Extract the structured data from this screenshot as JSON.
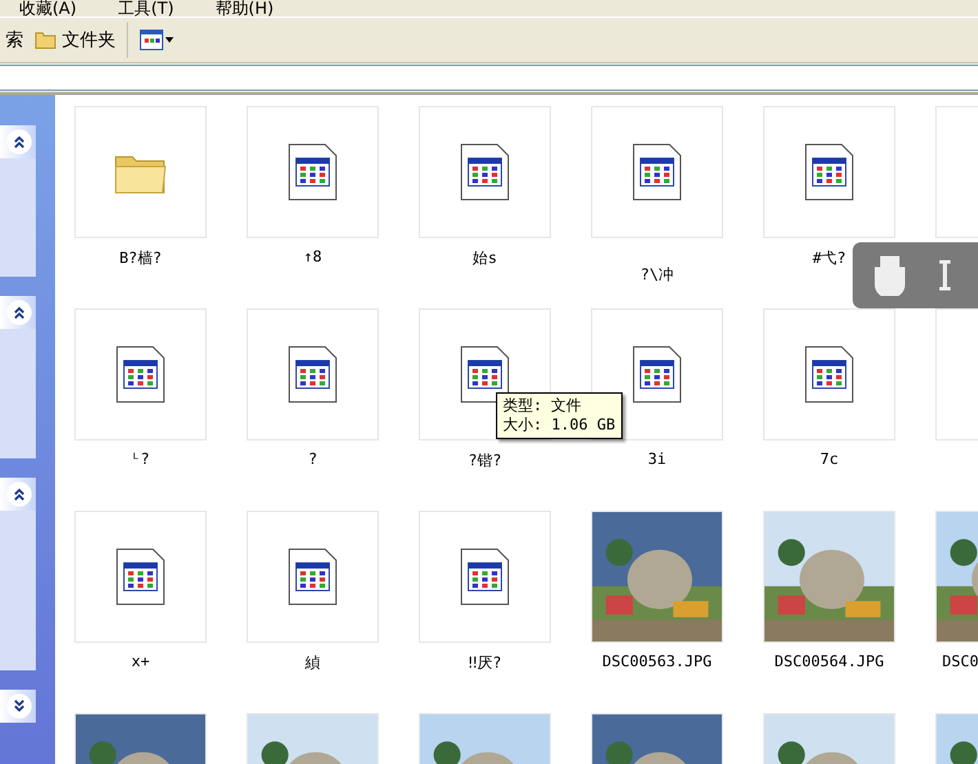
{
  "menu": [
    "收藏(A)",
    "工具(T)",
    "帮助(H)"
  ],
  "toolbar": {
    "search_label": "索",
    "folders_label": "文件夹"
  },
  "sidebar": {
    "panels": [
      {
        "expanded": true
      },
      {
        "expanded": true
      },
      {
        "expanded": true
      },
      {
        "expanded": false
      }
    ]
  },
  "items": [
    {
      "kind": "folder",
      "label": "B?樯?"
    },
    {
      "kind": "file",
      "label": "↑8"
    },
    {
      "kind": "file",
      "label": "始s"
    },
    {
      "kind": "file",
      "label": "?\\冲"
    },
    {
      "kind": "file",
      "label": "#弋?"
    },
    {
      "kind": "blank"
    },
    {
      "kind": "file",
      "label": "ᴸ?"
    },
    {
      "kind": "file",
      "label": "?"
    },
    {
      "kind": "file",
      "label": "?锴?"
    },
    {
      "kind": "file",
      "label": "3i"
    },
    {
      "kind": "file",
      "label": "7c"
    },
    {
      "kind": "blank"
    },
    {
      "kind": "file",
      "label": "x+"
    },
    {
      "kind": "file",
      "label": "緽"
    },
    {
      "kind": "file",
      "label": "‼厌?"
    },
    {
      "kind": "picture",
      "label": "DSC00563.JPG"
    },
    {
      "kind": "picture",
      "label": "DSC00564.JPG"
    },
    {
      "kind": "picture",
      "label": "DSC0"
    },
    {
      "kind": "picture"
    },
    {
      "kind": "picture"
    },
    {
      "kind": "picture"
    },
    {
      "kind": "picture"
    },
    {
      "kind": "picture"
    },
    {
      "kind": "picture"
    }
  ],
  "tooltip": [
    "类型: 文件",
    "大小: 1.06 GB"
  ]
}
